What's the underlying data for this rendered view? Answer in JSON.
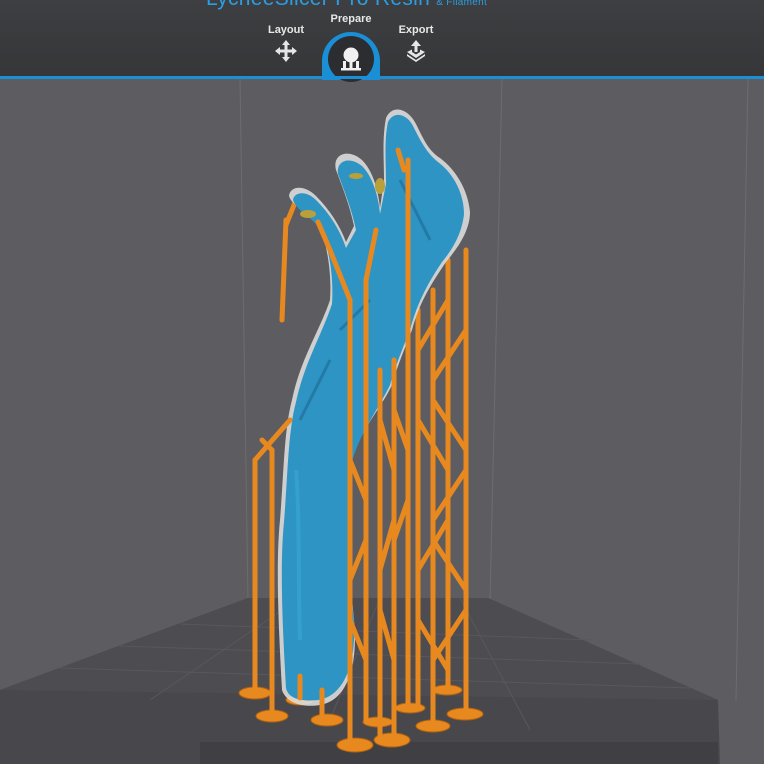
{
  "app": {
    "title": "LycheeSlicer Pro Resin",
    "title_suffix": "& Filament"
  },
  "tabs": [
    {
      "label": "Layout",
      "icon": "move-arrows-icon",
      "active": false
    },
    {
      "label": "Prepare",
      "icon": "supports-icon",
      "active": true
    },
    {
      "label": "Export",
      "icon": "export-upload-icon",
      "active": false
    }
  ],
  "colors": {
    "accent": "#1b8fd6",
    "model": "#2e94c4",
    "supports": "#e8891f",
    "viewport": "#5d5d61",
    "toolbar": "#3a3b3e"
  }
}
